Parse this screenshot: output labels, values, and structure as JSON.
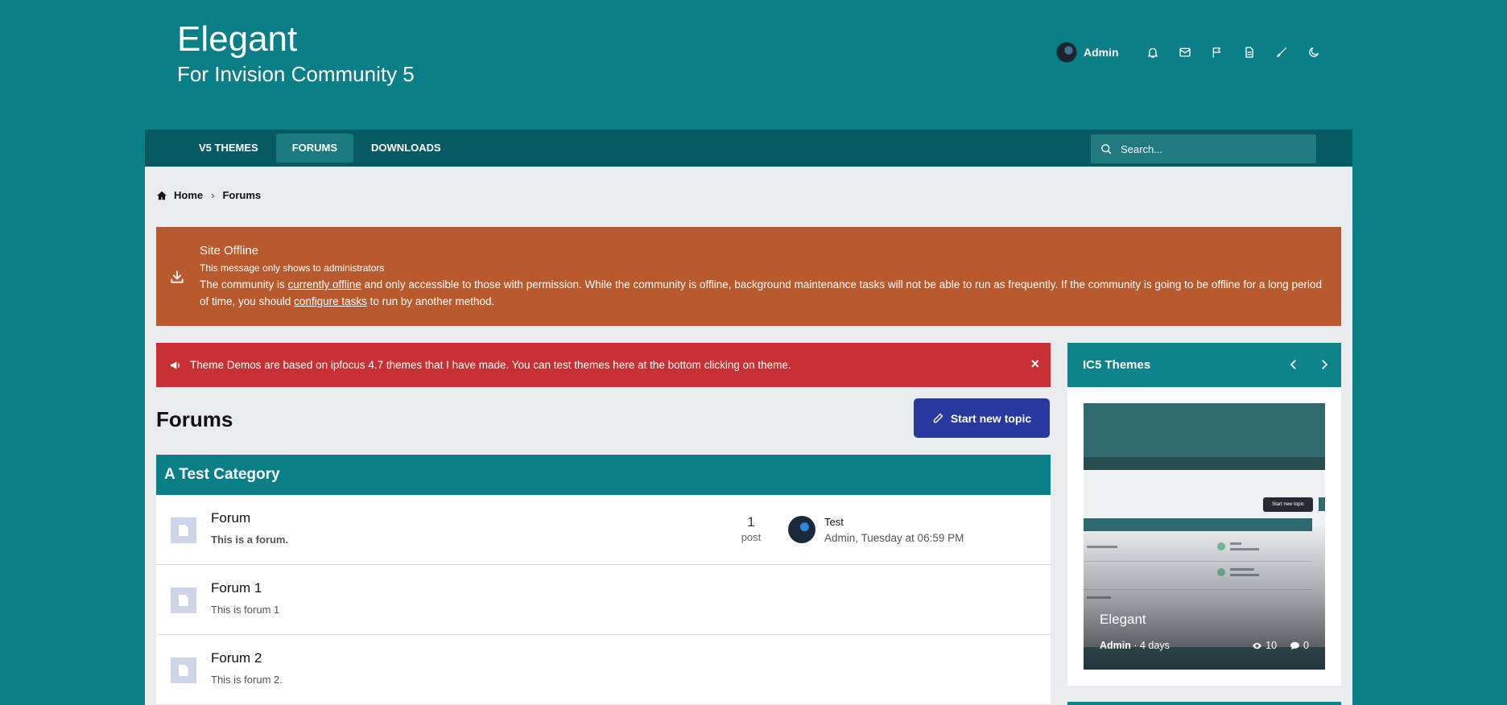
{
  "brand": {
    "title": "Elegant",
    "subtitle": "For Invision Community 5"
  },
  "user": {
    "name": "Admin"
  },
  "top_icons": [
    "bell-icon",
    "envelope-icon",
    "flag-icon",
    "document-icon",
    "paintbrush-icon",
    "moon-icon"
  ],
  "nav": {
    "items": [
      {
        "label": "V5 THEMES",
        "active": false
      },
      {
        "label": "FORUMS",
        "active": true
      },
      {
        "label": "DOWNLOADS",
        "active": false
      }
    ],
    "search_placeholder": "Search..."
  },
  "breadcrumb": {
    "home": "Home",
    "current": "Forums"
  },
  "offline": {
    "title": "Site Offline",
    "subtitle": "This message only shows to administrators",
    "body_1": "The community is ",
    "link_1": "currently offline",
    "body_2": " and only accessible to those with permission. While the community is offline, background maintenance tasks will not be able to run as frequently. If the community is going to be offline for a long period of time, you should ",
    "link_2": "configure tasks",
    "body_3": " to run by another method."
  },
  "announcement": {
    "text": "Theme Demos are based on ipfocus 4.7 themes that I have made. You can test themes here at the bottom clicking on theme.",
    "close": "×"
  },
  "page": {
    "title": "Forums",
    "start_button": "Start new topic"
  },
  "category": {
    "name": "A Test Category"
  },
  "forums": [
    {
      "name": "Forum",
      "description": "This is a forum.",
      "posts": "1",
      "posts_label": "post",
      "last_title": "Test",
      "last_meta": "Admin, Tuesday at 06:59 PM"
    },
    {
      "name": "Forum 1",
      "description": "This is forum 1"
    },
    {
      "name": "Forum 2",
      "description": "This is forum 2."
    }
  ],
  "widget": {
    "title": "IC5 Themes",
    "card": {
      "title": "Elegant",
      "author": "Admin",
      "time": " · 4 days",
      "views": "10",
      "comments": "0",
      "mini_button": "Start new topic"
    }
  },
  "colors": {
    "background": "#0a7f87",
    "nav": "#075a62",
    "offline": "#b95a2e",
    "announce": "#c73133",
    "button": "#2738a0"
  }
}
